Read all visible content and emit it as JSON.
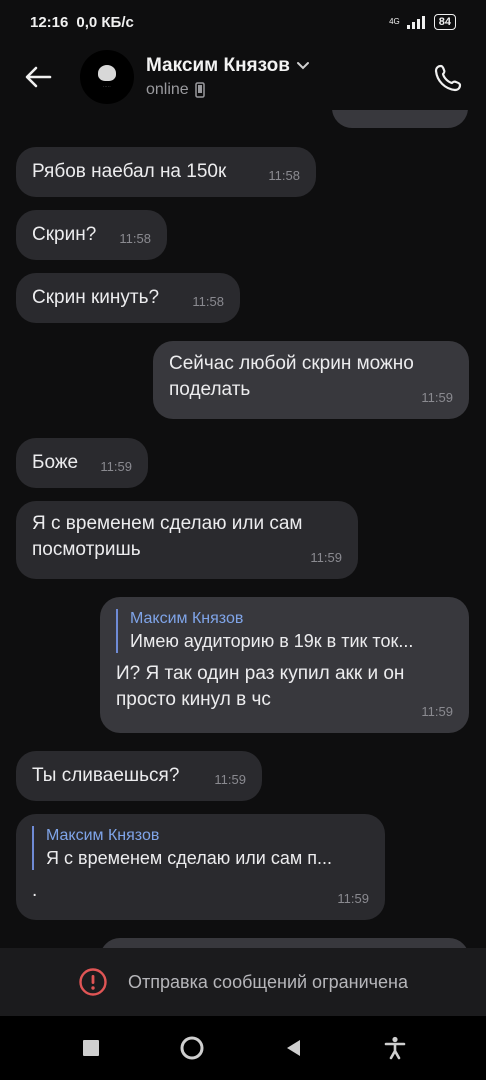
{
  "status_bar": {
    "time": "12:16",
    "speed": "0,0 КБ/с",
    "network": "4G",
    "battery": "84"
  },
  "header": {
    "contact_name": "Максим Князов",
    "status": "online",
    "icons": {
      "back": "arrow-left-icon",
      "dropdown": "chevron-down-icon",
      "device": "phone-device-icon",
      "call": "phone-call-icon"
    }
  },
  "messages": [
    {
      "dir": "in",
      "text": "Рябов наебал на 150к",
      "time": "11:58"
    },
    {
      "dir": "in",
      "text": "Скрин?",
      "time": "11:58"
    },
    {
      "dir": "in",
      "text": "Скрин кинуть?",
      "time": "11:58"
    },
    {
      "dir": "out",
      "text_line1": "Сейчас любой скрин можно",
      "text_line2": "поделать",
      "time": "11:59"
    },
    {
      "dir": "in",
      "text": "Боже",
      "time": "11:59"
    },
    {
      "dir": "in",
      "text_line1": "Я с временем сделаю или сам",
      "text_line2": "посмотришь",
      "time": "11:59"
    },
    {
      "dir": "out",
      "reply_name": "Максим Князов",
      "reply_text": "Имею аудиторию в 19к в тик ток...",
      "text_line1": "И? Я так один раз купил акк и он",
      "text_line2": "просто кинул в чс",
      "time": "11:59"
    },
    {
      "dir": "in",
      "text": "Ты сливаешься?",
      "time": "11:59"
    },
    {
      "dir": "in",
      "reply_name": "Максим Князов",
      "reply_text": "Я с временем сделаю или сам п...",
      "text": ".",
      "time": "11:59"
    }
  ],
  "restriction": {
    "text": "Отправка сообщений ограничена",
    "icon": "alert-circle-icon",
    "icon_color": "#e05555"
  },
  "nav": {
    "icons": [
      "square-icon",
      "circle-icon",
      "back-triangle-icon",
      "accessibility-icon"
    ]
  }
}
